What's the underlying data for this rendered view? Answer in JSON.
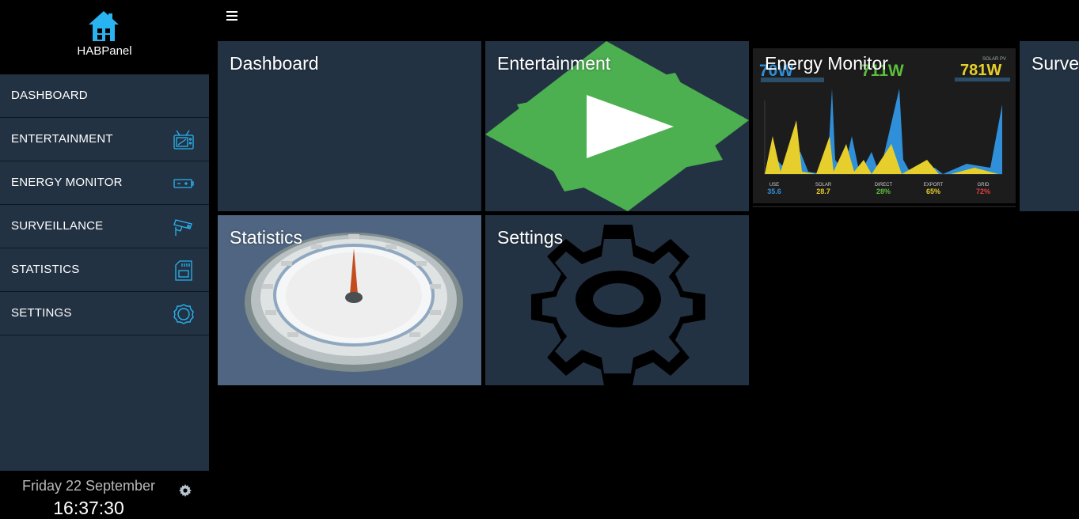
{
  "app": {
    "title": "HABPanel"
  },
  "menu": {
    "items": [
      {
        "label": "DASHBOARD",
        "icon": ""
      },
      {
        "label": "ENTERTAINMENT",
        "icon": "tv-icon"
      },
      {
        "label": "ENERGY MONITOR",
        "icon": "battery-icon"
      },
      {
        "label": "SURVEILLANCE",
        "icon": "camera-icon"
      },
      {
        "label": "STATISTICS",
        "icon": "sd-card-icon"
      },
      {
        "label": "SETTINGS",
        "icon": "gear-icon"
      }
    ]
  },
  "clock": {
    "date": "Friday 22 September",
    "time": "16:37:30"
  },
  "tiles": [
    {
      "name": "Dashboard"
    },
    {
      "name": "Entertainment"
    },
    {
      "name": "Energy Monitor"
    },
    {
      "name": "Surve"
    },
    {
      "name": "Statistics"
    },
    {
      "name": "Settings"
    }
  ],
  "energy_monitor": {
    "left_value": "70W",
    "middle_value": "711W",
    "right_label": "SOLAR PV",
    "right_value": "781W",
    "stats": [
      {
        "key": "USE",
        "value": "35.6",
        "color": "#2f8fd8"
      },
      {
        "key": "SOLAR",
        "value": "28.7",
        "color": "#e6cf2c"
      },
      {
        "key": "DIRECT",
        "value": "28%",
        "color": "#5bbf3a"
      },
      {
        "key": "EXPORT",
        "value": "65%",
        "color": "#e6cf2c"
      },
      {
        "key": "GRID",
        "value": "72%",
        "color": "#e04040"
      }
    ]
  },
  "colors": {
    "accent": "#29b3f0",
    "panel": "#233243",
    "play_green": "#4caf50"
  }
}
